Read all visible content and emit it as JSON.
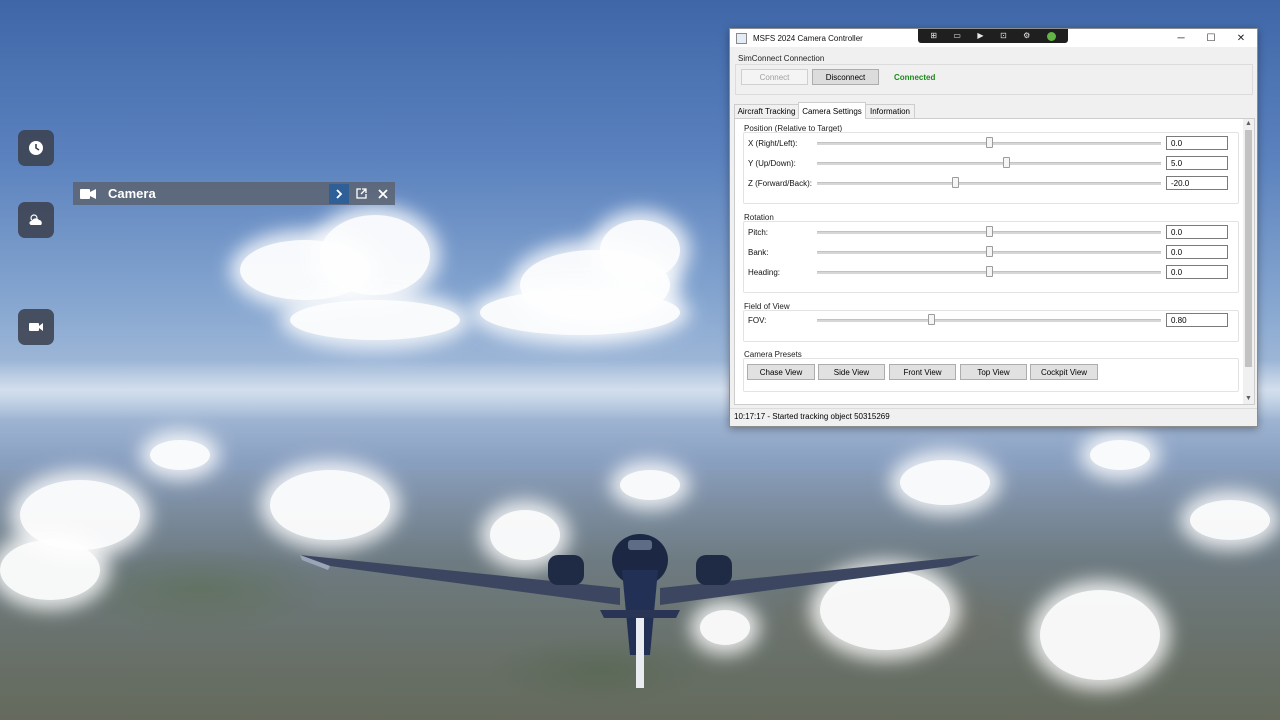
{
  "sim": {
    "dock": [
      {
        "icon": "clock-icon"
      },
      {
        "icon": "weather-icon"
      },
      {
        "icon": "camera-icon"
      }
    ],
    "camera_panel": {
      "title": "Camera",
      "buttons": [
        "chevron-right-icon",
        "popout-icon",
        "close-icon"
      ]
    }
  },
  "window": {
    "title": "MSFS 2024 Camera Controller",
    "controls": {
      "minimize": "─",
      "maximize": "☐",
      "close": "✕"
    },
    "debug_toolbar": [
      "⊞",
      "▭",
      "▶",
      "⊡",
      "⚙"
    ],
    "connection": {
      "group_title": "SimConnect Connection",
      "connect_label": "Connect",
      "disconnect_label": "Disconnect",
      "status": "Connected",
      "status_color": "#1b8a1b"
    },
    "tabs": [
      {
        "label": "Aircraft Tracking",
        "selected": false
      },
      {
        "label": "Camera Settings",
        "selected": true
      },
      {
        "label": "Information",
        "selected": false
      }
    ],
    "position": {
      "title": "Position (Relative to Target)",
      "rows": [
        {
          "label": "X (Right/Left):",
          "value": "0.0",
          "level": 0.5
        },
        {
          "label": "Y (Up/Down):",
          "value": "5.0",
          "level": 0.55
        },
        {
          "label": "Z (Forward/Back):",
          "value": "-20.0",
          "level": 0.4
        }
      ]
    },
    "rotation": {
      "title": "Rotation",
      "rows": [
        {
          "label": "Pitch:",
          "value": "0.0",
          "level": 0.5
        },
        {
          "label": "Bank:",
          "value": "0.0",
          "level": 0.5
        },
        {
          "label": "Heading:",
          "value": "0.0",
          "level": 0.5
        }
      ]
    },
    "fov": {
      "title": "Field of View",
      "rows": [
        {
          "label": "FOV:",
          "value": "0.80",
          "level": 0.33
        }
      ]
    },
    "presets": {
      "title": "Camera Presets",
      "buttons": [
        "Chase View",
        "Side View",
        "Front View",
        "Top View",
        "Cockpit View"
      ]
    },
    "status_bar": "10:17:17 - Started tracking object 50315269"
  }
}
